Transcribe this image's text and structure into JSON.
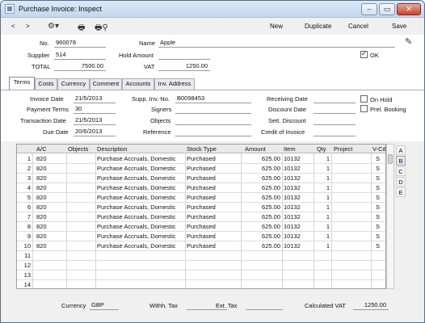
{
  "window": {
    "title": "Purchase Invoice: Inspect",
    "min": "–",
    "max": "▭",
    "close": "✕"
  },
  "toolbar": {
    "back": "<",
    "forward": ">",
    "new": "New",
    "duplicate": "Duplicate",
    "cancel": "Cancel",
    "save": "Save"
  },
  "header": {
    "no_label": "No.",
    "no": "960078",
    "name_label": "Name",
    "name": "Apple",
    "supplier_label": "Supplier",
    "supplier": "514",
    "hold_label": "Hold Amount",
    "hold": "",
    "total_label": "TOTAL",
    "total": "7500.00",
    "vat_label": "VAT",
    "vat": "1250.00",
    "ok_label": "OK",
    "ok_checked": true
  },
  "tabs": [
    "Terms",
    "Costs",
    "Currency",
    "Comment",
    "Accounts",
    "Inv. Address"
  ],
  "terms": {
    "invoice_date_label": "Invoice Date",
    "invoice_date": "21/5/2013",
    "payment_terms_label": "Payment Terms",
    "payment_terms": "30",
    "transaction_date_label": "Transaction Date",
    "transaction_date": "21/5/2013",
    "due_date_label": "Due Date",
    "due_date": "20/6/2013",
    "supp_inv_label": "Supp. Inv. No.",
    "supp_inv": "B0098453",
    "signers_label": "Signers",
    "signers": "",
    "objects_label": "Objects",
    "objects": "",
    "reference_label": "Reference",
    "reference": "",
    "receiving_label": "Receiving Date",
    "receiving": "",
    "discount_label": "Discount Date",
    "discount": "",
    "sett_label": "Sett. Discount",
    "sett": "",
    "credit_label": "Credit of Invoice",
    "credit": "",
    "onhold_label": "On Hold",
    "prel_label": "Prel. Booking"
  },
  "grid": {
    "headers": [
      "A/C",
      "Objects",
      "Description",
      "Stock Type",
      "Amount",
      "Item",
      "Qty",
      "Project",
      "V-Cd"
    ],
    "rows": [
      [
        "1",
        "820",
        "",
        "Purchase Accruals, Domestic",
        "Purchased",
        "625.00",
        "10132",
        "1",
        "",
        "S"
      ],
      [
        "2",
        "820",
        "",
        "Purchase Accruals, Domestic",
        "Purchased",
        "625.00",
        "10132",
        "1",
        "",
        "S"
      ],
      [
        "3",
        "820",
        "",
        "Purchase Accruals, Domestic",
        "Purchased",
        "625.00",
        "10132",
        "1",
        "",
        "S"
      ],
      [
        "4",
        "820",
        "",
        "Purchase Accruals, Domestic",
        "Purchased",
        "625.00",
        "10132",
        "1",
        "",
        "S"
      ],
      [
        "5",
        "820",
        "",
        "Purchase Accruals, Domestic",
        "Purchased",
        "625.00",
        "10132",
        "1",
        "",
        "S"
      ],
      [
        "6",
        "820",
        "",
        "Purchase Accruals, Domestic",
        "Purchased",
        "625.00",
        "10132",
        "1",
        "",
        "S"
      ],
      [
        "7",
        "820",
        "",
        "Purchase Accruals, Domestic",
        "Purchased",
        "625.00",
        "10132",
        "1",
        "",
        "S"
      ],
      [
        "8",
        "820",
        "",
        "Purchase Accruals, Domestic",
        "Purchased",
        "625.00",
        "10132",
        "1",
        "",
        "S"
      ],
      [
        "9",
        "820",
        "",
        "Purchase Accruals, Domestic",
        "Purchased",
        "625.00",
        "10132",
        "1",
        "",
        "S"
      ],
      [
        "10",
        "820",
        "",
        "Purchase Accruals, Domestic",
        "Purchased",
        "625.00",
        "10132",
        "1",
        "",
        "S"
      ],
      [
        "11",
        "",
        "",
        "",
        "",
        "",
        "",
        "",
        "",
        ""
      ],
      [
        "12",
        "",
        "",
        "",
        "",
        "",
        "",
        "",
        "",
        ""
      ],
      [
        "13",
        "",
        "",
        "",
        "",
        "",
        "",
        "",
        "",
        ""
      ],
      [
        "14",
        "",
        "",
        "",
        "",
        "",
        "",
        "",
        "",
        ""
      ]
    ],
    "side_tabs": [
      "A",
      "B",
      "C",
      "D",
      "E"
    ],
    "active_side_tab": "B"
  },
  "footer": {
    "currency_label": "Currency",
    "currency": "GBP",
    "withh_label": "Withh. Tax",
    "withh": "",
    "ext_label": "Ext. Tax",
    "ext": "",
    "calc_vat_label": "Calculated VAT",
    "calc_vat": "1250.00"
  },
  "icons": {
    "gear": "gear-icon",
    "print": "printer-icon",
    "preview": "print-preview-icon",
    "edit": "edit-icon"
  }
}
